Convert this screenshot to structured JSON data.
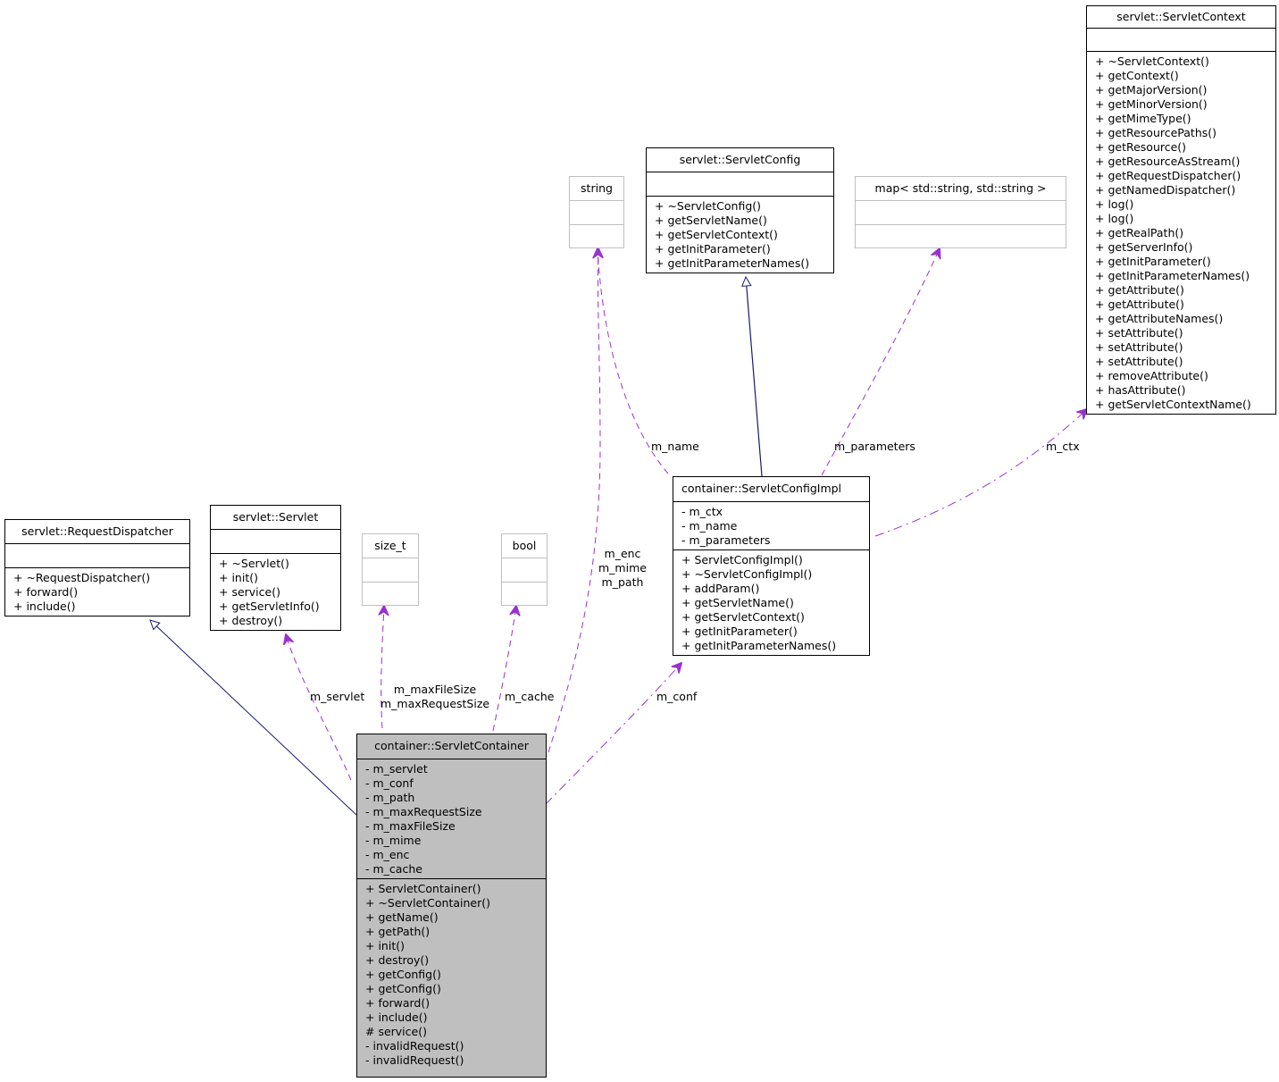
{
  "diagram": {
    "type": "uml-collaboration",
    "colors": {
      "inheritance_edge": "#191970",
      "usage_edge": "#9a32cd",
      "focus_fill": "#bfbfbf",
      "external_border": "#bfbfbf"
    },
    "classes": {
      "servlet_context": {
        "name": "servlet::ServletContext",
        "attributes": [],
        "methods": [
          "+ ~ServletContext()",
          "+ getContext()",
          "+ getMajorVersion()",
          "+ getMinorVersion()",
          "+ getMimeType()",
          "+ getResourcePaths()",
          "+ getResource()",
          "+ getResourceAsStream()",
          "+ getRequestDispatcher()",
          "+ getNamedDispatcher()",
          "+ log()",
          "+ log()",
          "+ getRealPath()",
          "+ getServerInfo()",
          "+ getInitParameter()",
          "+ getInitParameterNames()",
          "+ getAttribute()",
          "+ getAttribute()",
          "+ getAttributeNames()",
          "+ setAttribute()",
          "+ setAttribute()",
          "+ setAttribute()",
          "+ removeAttribute()",
          "+ hasAttribute()",
          "+ getServletContextName()"
        ]
      },
      "servlet_config": {
        "name": "servlet::ServletConfig",
        "attributes": [],
        "methods": [
          "+ ~ServletConfig()",
          "+ getServletName()",
          "+ getServletContext()",
          "+ getInitParameter()",
          "+ getInitParameterNames()"
        ]
      },
      "string": {
        "name": "string",
        "attributes": [],
        "methods": []
      },
      "map": {
        "name": "map< std::string, std::string >",
        "attributes": [],
        "methods": []
      },
      "servlet_config_impl": {
        "name": "container::ServletConfigImpl",
        "attributes": [
          "- m_ctx",
          "- m_name",
          "- m_parameters"
        ],
        "methods": [
          "+ ServletConfigImpl()",
          "+ ~ServletConfigImpl()",
          "+ addParam()",
          "+ getServletName()",
          "+ getServletContext()",
          "+ getInitParameter()",
          "+ getInitParameterNames()"
        ]
      },
      "request_dispatcher": {
        "name": "servlet::RequestDispatcher",
        "attributes": [],
        "methods": [
          "+ ~RequestDispatcher()",
          "+ forward()",
          "+ include()"
        ]
      },
      "servlet": {
        "name": "servlet::Servlet",
        "attributes": [],
        "methods": [
          "+ ~Servlet()",
          "+ init()",
          "+ service()",
          "+ getServletInfo()",
          "+ destroy()"
        ]
      },
      "size_t": {
        "name": "size_t",
        "attributes": [],
        "methods": []
      },
      "bool": {
        "name": "bool",
        "attributes": [],
        "methods": []
      },
      "servlet_container": {
        "name": "container::ServletContainer",
        "attributes": [
          "- m_servlet",
          "- m_conf",
          "- m_path",
          "- m_maxRequestSize",
          "- m_maxFileSize",
          "- m_mime",
          "- m_enc",
          "- m_cache"
        ],
        "methods": [
          "+ ServletContainer()",
          "+ ~ServletContainer()",
          "+ getName()",
          "+ getPath()",
          "+ init()",
          "+ destroy()",
          "+ getConfig()",
          "+ getConfig()",
          "+ forward()",
          "+ include()",
          "# service()",
          "- invalidRequest()",
          "- invalidRequest()"
        ]
      }
    },
    "edges": [
      {
        "from": "servlet_config_impl",
        "to": "servlet_config",
        "kind": "inheritance",
        "label": ""
      },
      {
        "from": "servlet_container",
        "to": "request_dispatcher",
        "kind": "inheritance",
        "label": ""
      },
      {
        "from": "servlet_config_impl",
        "to": "string",
        "kind": "usage",
        "label": "m_name"
      },
      {
        "from": "servlet_config_impl",
        "to": "map",
        "kind": "usage",
        "label": "m_parameters"
      },
      {
        "from": "servlet_config_impl",
        "to": "servlet_context",
        "kind": "usage",
        "label": "m_ctx"
      },
      {
        "from": "servlet_container",
        "to": "servlet",
        "kind": "usage",
        "label": "m_servlet"
      },
      {
        "from": "servlet_container",
        "to": "size_t",
        "kind": "usage",
        "label": "m_maxFileSize\nm_maxRequestSize"
      },
      {
        "from": "servlet_container",
        "to": "bool",
        "kind": "usage",
        "label": "m_cache"
      },
      {
        "from": "servlet_container",
        "to": "string",
        "kind": "usage",
        "label": "m_enc\nm_mime\nm_path"
      },
      {
        "from": "servlet_container",
        "to": "servlet_config_impl",
        "kind": "usage",
        "label": "m_conf"
      }
    ],
    "labels": {
      "m_name": "m_name",
      "m_parameters": "m_parameters",
      "m_ctx": "m_ctx",
      "m_servlet": "m_servlet",
      "m_size": [
        "m_maxFileSize",
        "m_maxRequestSize"
      ],
      "m_cache": "m_cache",
      "m_string": [
        "m_enc",
        "m_mime",
        "m_path"
      ],
      "m_conf": "m_conf"
    }
  }
}
